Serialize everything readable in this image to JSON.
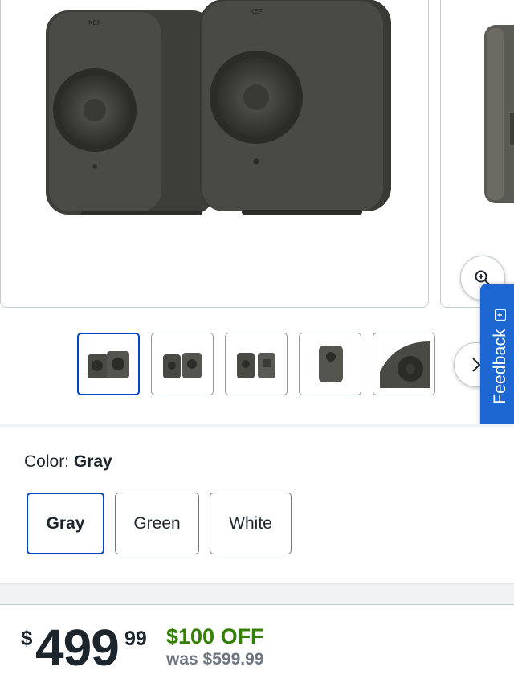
{
  "gallery": {
    "brand_mark": "KEF",
    "thumbnails": [
      {
        "name": "speaker-pair-front",
        "selected": true
      },
      {
        "name": "speaker-pair-angle",
        "selected": false
      },
      {
        "name": "speaker-pair-back",
        "selected": false
      },
      {
        "name": "speaker-single-side",
        "selected": false
      },
      {
        "name": "driver-closeup",
        "selected": false
      }
    ]
  },
  "feedback": {
    "label": "Feedback"
  },
  "color": {
    "label": "Color:",
    "selected": "Gray",
    "options": [
      "Gray",
      "Green",
      "White"
    ]
  },
  "price": {
    "currency": "$",
    "dollars": "499",
    "cents": "99",
    "savings": "$100 OFF",
    "was": "was $599.99"
  },
  "colors": {
    "accent": "#0046be",
    "savings": "#318000",
    "feedback": "#1d67d3",
    "speaker": "#4a4a44"
  }
}
